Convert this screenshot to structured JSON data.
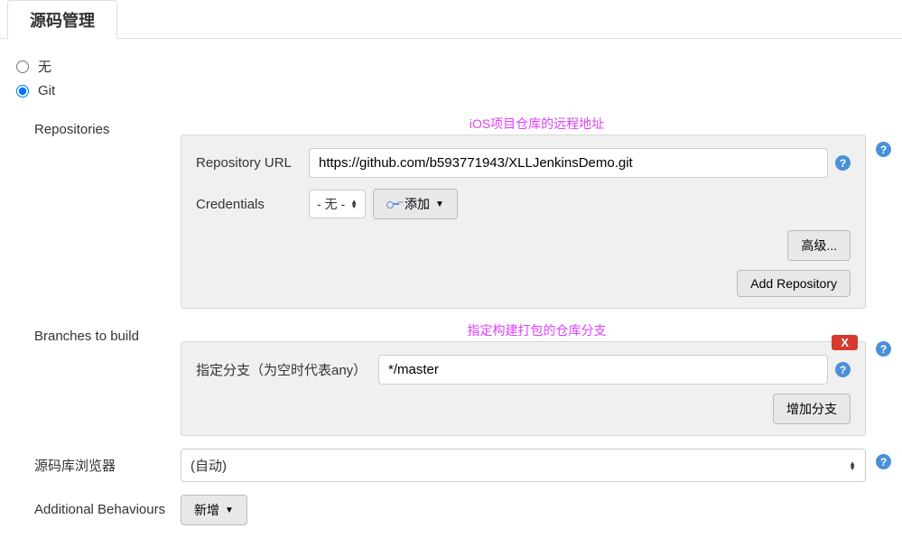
{
  "tab": {
    "label": "源码管理"
  },
  "scm": {
    "options": {
      "none": {
        "label": "无",
        "checked": false
      },
      "git": {
        "label": "Git",
        "checked": true
      }
    }
  },
  "repositories": {
    "section_label": "Repositories",
    "annotation": "iOS项目仓库的远程地址",
    "url_label": "Repository URL",
    "url_value": "https://github.com/b593771943/XLLJenkinsDemo.git",
    "credentials_label": "Credentials",
    "credentials_value": "- 无 -",
    "add_cred_label": "添加",
    "advanced_label": "高级...",
    "add_repo_label": "Add Repository"
  },
  "branches": {
    "section_label": "Branches to build",
    "annotation": "指定构建打包的仓库分支",
    "field_label": "指定分支（为空时代表any）",
    "value": "*/master",
    "delete_label": "X",
    "add_branch_label": "增加分支"
  },
  "browser": {
    "section_label": "源码库浏览器",
    "value": "(自动)"
  },
  "behaviours": {
    "section_label": "Additional Behaviours",
    "add_label": "新增"
  }
}
